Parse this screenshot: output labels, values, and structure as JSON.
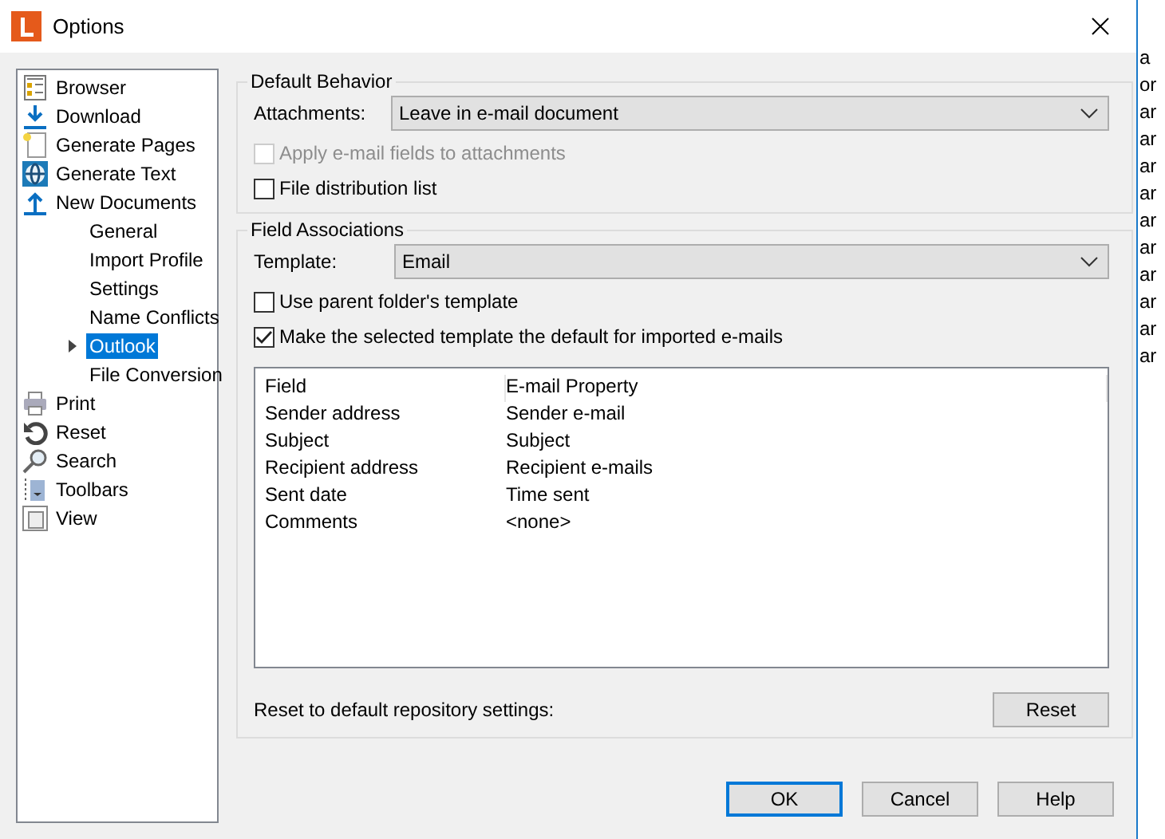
{
  "window": {
    "title": "Options"
  },
  "sidebar": {
    "items": [
      {
        "label": "Browser",
        "kind": "browser",
        "selected": false
      },
      {
        "label": "Download",
        "kind": "download",
        "selected": false
      },
      {
        "label": "Generate Pages",
        "kind": "pages",
        "selected": false
      },
      {
        "label": "Generate Text",
        "kind": "text",
        "selected": false
      },
      {
        "label": "New Documents",
        "kind": "upload",
        "selected": false,
        "children": [
          {
            "label": "General",
            "selected": false
          },
          {
            "label": "Import Profile",
            "selected": false
          },
          {
            "label": "Settings",
            "selected": false
          },
          {
            "label": "Name Conflicts",
            "selected": false
          },
          {
            "label": "Outlook",
            "selected": true,
            "expanded": false
          },
          {
            "label": "File Conversion",
            "selected": false
          }
        ]
      },
      {
        "label": "Print",
        "kind": "print",
        "selected": false
      },
      {
        "label": "Reset",
        "kind": "reset",
        "selected": false
      },
      {
        "label": "Search",
        "kind": "search",
        "selected": false
      },
      {
        "label": "Toolbars",
        "kind": "toolbars",
        "selected": false
      },
      {
        "label": "View",
        "kind": "view",
        "selected": false
      }
    ]
  },
  "default_behavior": {
    "title": "Default Behavior",
    "attachments": {
      "label": "Attachments:",
      "value": "Leave in e-mail document"
    },
    "checkboxes": [
      {
        "label": "Apply e-mail fields to attachments",
        "checked": false,
        "disabled": true
      },
      {
        "label": "File distribution list",
        "checked": false,
        "disabled": false
      }
    ]
  },
  "field_associations": {
    "title": "Field Associations",
    "template": {
      "label": "Template:",
      "value": "Email"
    },
    "checkboxes": [
      {
        "label": "Use parent folder's template",
        "checked": false,
        "disabled": false
      },
      {
        "label": "Make the selected template the default for imported e-mails",
        "checked": true,
        "disabled": false
      }
    ],
    "table": {
      "columns": [
        "Field",
        "E-mail Property"
      ],
      "rows": [
        [
          "Sender address",
          "Sender e-mail"
        ],
        [
          "Subject",
          "Subject"
        ],
        [
          "Recipient address",
          "Recipient e-mails"
        ],
        [
          "Sent date",
          "Time sent"
        ],
        [
          "Comments",
          "<none>"
        ]
      ]
    },
    "reset_label": "Reset to default repository settings:",
    "reset_button": "Reset"
  },
  "buttons": [
    {
      "label": "OK",
      "default": true
    },
    {
      "label": "Cancel",
      "default": false
    },
    {
      "label": "Help",
      "default": false
    }
  ],
  "background_window": {
    "text_fragments": [
      "a",
      "or",
      "ar",
      "ar",
      "ar",
      "ar",
      "ar",
      "ar",
      "ar",
      "ar",
      "ar",
      "ar"
    ]
  }
}
